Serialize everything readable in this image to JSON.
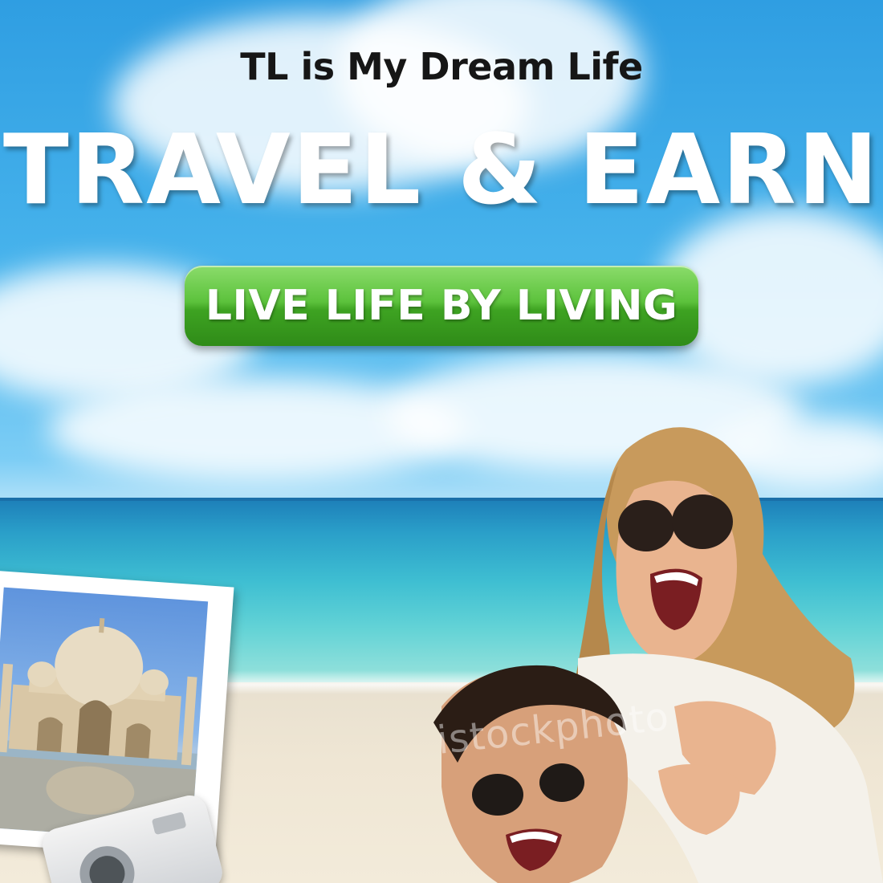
{
  "banner": {
    "tagline": "TL is My Dream Life",
    "headline": "TRAVEL & EARN",
    "cta_label": "LIVE LIFE BY LIVING",
    "watermark": "istockphoto"
  },
  "colors": {
    "sky": "#3aa8e8",
    "cta_green": "#4cb52e",
    "headline_text": "#ffffff",
    "tagline_text": "#161616",
    "sea": "#3fbfd2",
    "sand": "#efe6d4"
  },
  "images": {
    "photo_subject": "taj-mahal",
    "foreground": "laughing-couple-on-beach",
    "camera": "compact-camera"
  }
}
